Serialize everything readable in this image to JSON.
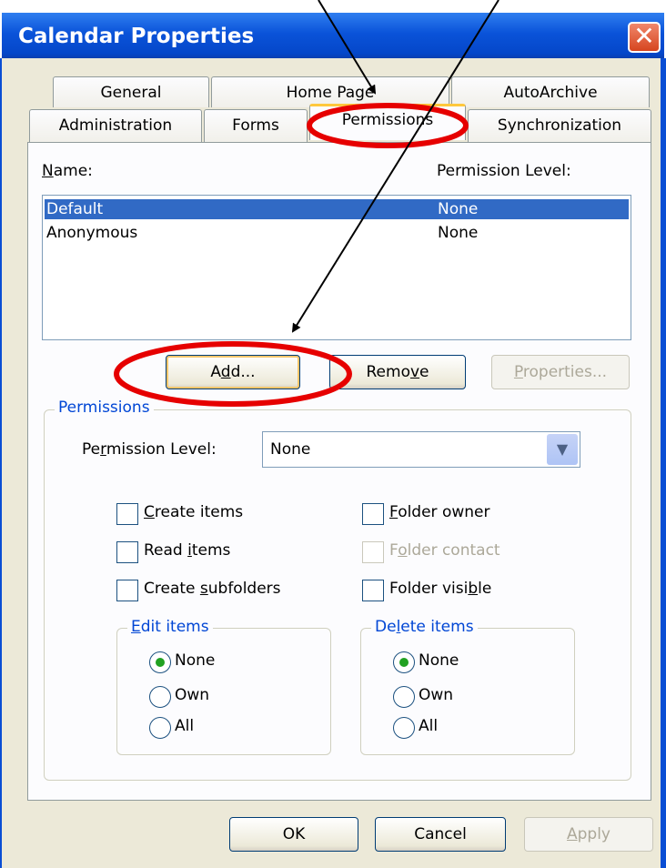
{
  "window": {
    "title": "Calendar Properties",
    "close_symbol": "✕"
  },
  "tabs": {
    "row1": [
      "General",
      "Home Page",
      "AutoArchive"
    ],
    "row2": [
      "Administration",
      "Forms",
      "Permissions",
      "Synchronization"
    ],
    "active": "Permissions"
  },
  "list": {
    "name_header": "Name:",
    "name_header_mnemonic": "N",
    "name_header_rest": "ame:",
    "level_header": "Permission Level:",
    "rows": [
      {
        "name": "Default",
        "level": "None",
        "selected": true
      },
      {
        "name": "Anonymous",
        "level": "None",
        "selected": false
      }
    ]
  },
  "list_buttons": {
    "add": {
      "pre": "A",
      "mn": "d",
      "post": "d..."
    },
    "remove": {
      "pre": "Remo",
      "mn": "v",
      "post": "e"
    },
    "properties": {
      "pre": "",
      "mn": "P",
      "post": "roperties..."
    }
  },
  "permissions": {
    "group_title": "Permissions",
    "level_label": {
      "pre": "Pe",
      "mn": "r",
      "post": "mission Level:"
    },
    "level_value": "None",
    "checkboxes": [
      {
        "pre": "",
        "mn": "C",
        "post": "reate items",
        "checked": false,
        "enabled": true
      },
      {
        "pre": "Read ",
        "mn": "i",
        "post": "tems",
        "checked": false,
        "enabled": true
      },
      {
        "pre": "Create ",
        "mn": "s",
        "post": "ubfolders",
        "checked": false,
        "enabled": true
      },
      {
        "pre": "",
        "mn": "F",
        "post": "older owner",
        "checked": false,
        "enabled": true
      },
      {
        "pre": "F",
        "mn": "o",
        "post": "lder contact",
        "checked": false,
        "enabled": false
      },
      {
        "pre": "Folder visi",
        "mn": "b",
        "post": "le",
        "checked": false,
        "enabled": true
      }
    ],
    "edit_items": {
      "title_pre": "",
      "title_mn": "E",
      "title_post": "dit items",
      "options": [
        "None",
        "Own",
        "All"
      ],
      "selected": "None"
    },
    "delete_items": {
      "title_pre": "De",
      "title_mn": "l",
      "title_post": "ete items",
      "options": [
        "None",
        "Own",
        "All"
      ],
      "selected": "None"
    }
  },
  "footer": {
    "ok": "OK",
    "cancel": "Cancel",
    "apply": {
      "pre": "",
      "mn": "A",
      "post": "pply"
    }
  },
  "annotations": {
    "highlight_color": "#e60000",
    "arrow_color": "#000000"
  }
}
